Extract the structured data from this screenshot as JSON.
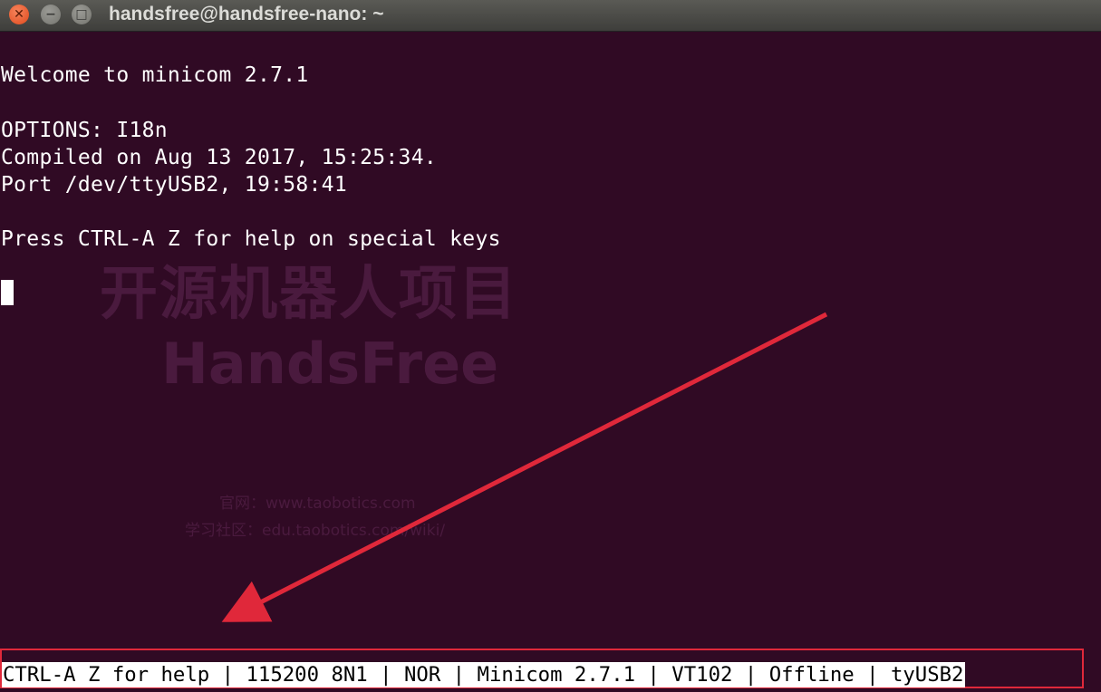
{
  "window": {
    "title": "handsfree@handsfree-nano: ~",
    "buttons": [
      "close",
      "minimize",
      "maximize"
    ]
  },
  "terminal": {
    "lines": [
      "Welcome to minicom 2.7.1",
      "OPTIONS: I18n",
      "Compiled on Aug 13 2017, 15:25:34.",
      "Port /dev/ttyUSB2, 19:58:41",
      "Press CTRL-A Z for help on special keys"
    ],
    "status_bar": "CTRL-A Z for help | 115200 8N1 | NOR | Minicom 2.7.1 | VT102 | Offline | tyUSB2"
  },
  "watermark": {
    "title_cn": "开源机器人项目",
    "title_en": "HandsFree",
    "site_line": "官网：www.taobotics.com",
    "wiki_line": "学习社区：edu.taobotics.com/wiki/"
  },
  "colors": {
    "terminal_bg": "#300a24",
    "text": "#ffffff",
    "annotation": "#e0283a",
    "close_button": "#e0491c"
  },
  "icons": [
    "close-icon",
    "minimize-icon",
    "maximize-icon",
    "arrow-annotation"
  ]
}
